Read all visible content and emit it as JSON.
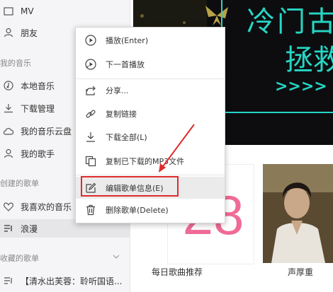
{
  "sidebar": {
    "items": [
      {
        "label": "MV",
        "icon": "mv-icon"
      },
      {
        "label": "朋友",
        "icon": "friends-icon"
      },
      {
        "label": "本地音乐",
        "icon": "music-note-icon"
      },
      {
        "label": "下载管理",
        "icon": "download-icon"
      },
      {
        "label": "我的音乐云盘",
        "icon": "cloud-icon"
      },
      {
        "label": "我的歌手",
        "icon": "singer-icon"
      },
      {
        "label": "我喜欢的音乐",
        "icon": "heart-icon"
      },
      {
        "label": "浪漫",
        "icon": "playlist-icon"
      },
      {
        "label": "【清水出芙蓉：聆听国语...",
        "icon": "playlist-icon"
      }
    ],
    "sections": {
      "my_music": "我的音乐",
      "created": "创建的歌单",
      "collected": "收藏的歌单"
    }
  },
  "main": {
    "banner": {
      "line1": "冷门古",
      "line2": "拯救",
      "line3": ">>>> 立"
    },
    "daily": {
      "number": "28",
      "caption": "每日歌曲推荐"
    },
    "second_caption": "声厚重"
  },
  "menu": {
    "items": [
      {
        "label": "播放(Enter)",
        "icon": "play-icon"
      },
      {
        "label": "下一首播放",
        "icon": "play-next-icon"
      },
      {
        "label": "分享...",
        "icon": "share-icon"
      },
      {
        "label": "复制链接",
        "icon": "link-icon"
      },
      {
        "label": "下载全部(L)",
        "icon": "download-icon"
      },
      {
        "label": "复制已下载的MP3文件",
        "icon": "copy-icon"
      },
      {
        "label": "编辑歌单信息(E)",
        "icon": "edit-icon"
      },
      {
        "label": "删除歌单(Delete)",
        "icon": "trash-icon"
      }
    ]
  },
  "colors": {
    "accent_teal": "#26d6c4",
    "daily_pink": "#f06b95",
    "highlight_red": "#e02b2b"
  }
}
